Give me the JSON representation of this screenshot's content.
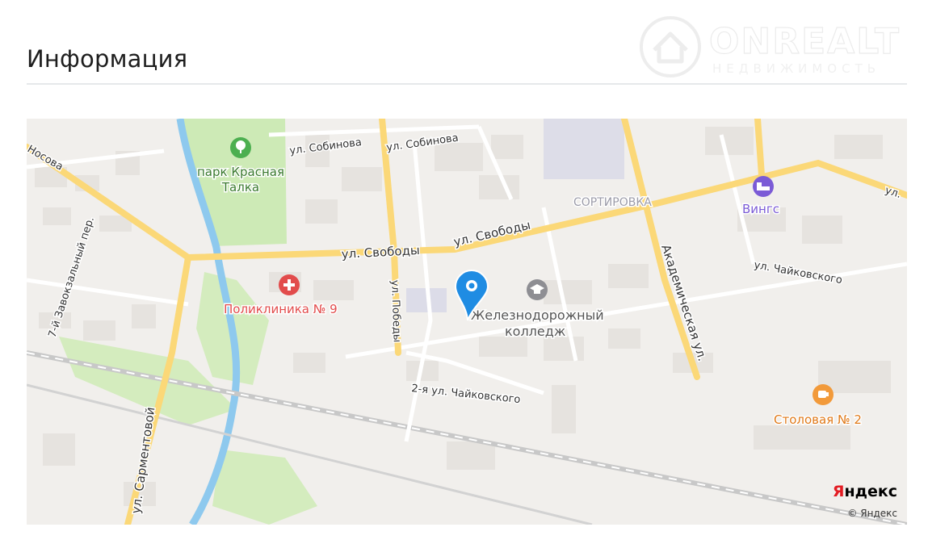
{
  "section": {
    "title": "Информация"
  },
  "watermark": {
    "brand": "ONREALT",
    "subtitle": "НЕДВИЖИМОСТЬ"
  },
  "map": {
    "provider_logo_first": "Я",
    "provider_logo_rest": "ндекс",
    "copyright": "© Яндекс",
    "streets": {
      "nosova": "Носова",
      "sobinova_1": "ул. Собинова",
      "sobinova_2": "ул. Собинова",
      "svobody_1": "ул. Свободы",
      "svobody_2": "ул. Свободы",
      "ul_right": "ул.",
      "chaikovskogo": "ул. Чайковского",
      "zavokzalny": "7-й Завокзальный пер.",
      "pobedy": "ул. Победы",
      "akademicheskaya": "Академическая ул.",
      "chaikovskogo_2": "2-я ул. Чайковского",
      "sarmentovoi": "ул. Сарментовой"
    },
    "district": "СОРТИРОВКА",
    "poi": {
      "park": [
        "парк Красная",
        "Талка"
      ],
      "polyclinic": "Поликлиника № 9",
      "college": [
        "Железнодорожный",
        "колледж"
      ],
      "hotel": "Вингс",
      "canteen": "Столовая № 2"
    },
    "colors": {
      "road_major": "#fbd878",
      "poi_medical": "#e24c4c",
      "poi_hotel": "#7b5bd6",
      "poi_food": "#f29a3a",
      "marker": "#1f8ce3",
      "park": "#cdeab6",
      "water": "#8ec9ee"
    },
    "icons": [
      "park-icon",
      "hospital-icon",
      "graduation-cap-icon",
      "hotel-bed-icon",
      "cup-icon",
      "location-pin-icon"
    ]
  }
}
